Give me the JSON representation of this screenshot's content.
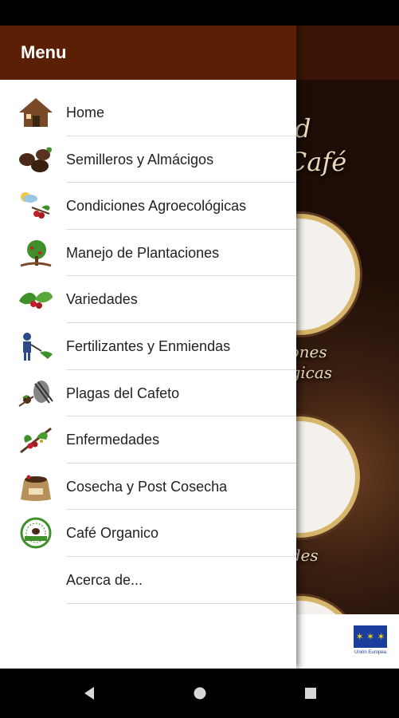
{
  "drawer": {
    "title": "Menu",
    "items": [
      {
        "label": "Home",
        "icon": "house-icon"
      },
      {
        "label": "Semilleros y Almácigos",
        "icon": "coffee-beans-icon"
      },
      {
        "label": "Condiciones Agroecológicas",
        "icon": "weather-cherries-icon"
      },
      {
        "label": "Manejo de Plantaciones",
        "icon": "plantation-tree-icon"
      },
      {
        "label": "Variedades",
        "icon": "coffee-leaves-icon"
      },
      {
        "label": "Fertilizantes y Enmiendas",
        "icon": "farmer-sprayer-icon"
      },
      {
        "label": "Plagas del Cafeto",
        "icon": "pest-icon"
      },
      {
        "label": "Enfermedades",
        "icon": "diseased-branch-icon"
      },
      {
        "label": "Cosecha y Post Cosecha",
        "icon": "coffee-sack-icon"
      },
      {
        "label": "Café Organico",
        "icon": "organic-seal-icon"
      },
      {
        "label": "Acerca de...",
        "icon": ""
      }
    ]
  },
  "background": {
    "title_line1": "d",
    "title_line2": "n Café",
    "label1_line1": "ciones",
    "label1_line2": "ológicas",
    "label2": "dades",
    "footer_caption": "Unión Europea"
  },
  "colors": {
    "header": "#5b1f06",
    "toolbar": "#3b1606",
    "gold": "#d6b46a"
  },
  "nav": {
    "back": "back-icon",
    "home": "home-circle-icon",
    "recents": "recents-square-icon"
  }
}
